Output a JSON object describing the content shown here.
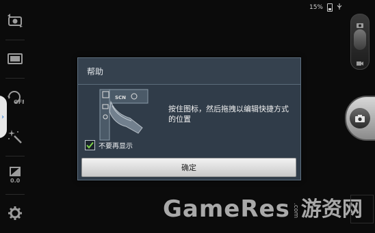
{
  "status_bar": {
    "battery_text": "15%",
    "battery_icon": "battery-icon",
    "usb_icon": "usb-icon"
  },
  "left_toolbar": {
    "items": [
      {
        "name": "switch-camera-icon"
      },
      {
        "name": "picture-size-icon"
      },
      {
        "name": "flash-off-icon",
        "label": "OFF"
      },
      {
        "name": "effects-wand-icon"
      },
      {
        "name": "exposure-icon",
        "label": "0.0"
      },
      {
        "name": "settings-gear-icon"
      }
    ],
    "tab_handle_glyph": "›"
  },
  "right_bar": {
    "mode_icons": [
      "camera-icon",
      "video-icon"
    ],
    "shutter_icon": "camera-icon"
  },
  "dialog": {
    "title": "帮助",
    "illustration_labels": {
      "scn": "SCN"
    },
    "message": "按住图标，然后拖拽以编辑快捷方式的位置",
    "checkbox_label": "不要再显示",
    "checkbox_checked": true,
    "ok_label": "确定"
  },
  "watermark": {
    "main": "GameRes",
    "dotcom": ".com",
    "cn": "游资网"
  },
  "colors": {
    "background": "#0b0b0b",
    "dialog_bg": "#303c49",
    "check_green": "#7fd24a",
    "accent_blue": "#4b8fd9"
  }
}
